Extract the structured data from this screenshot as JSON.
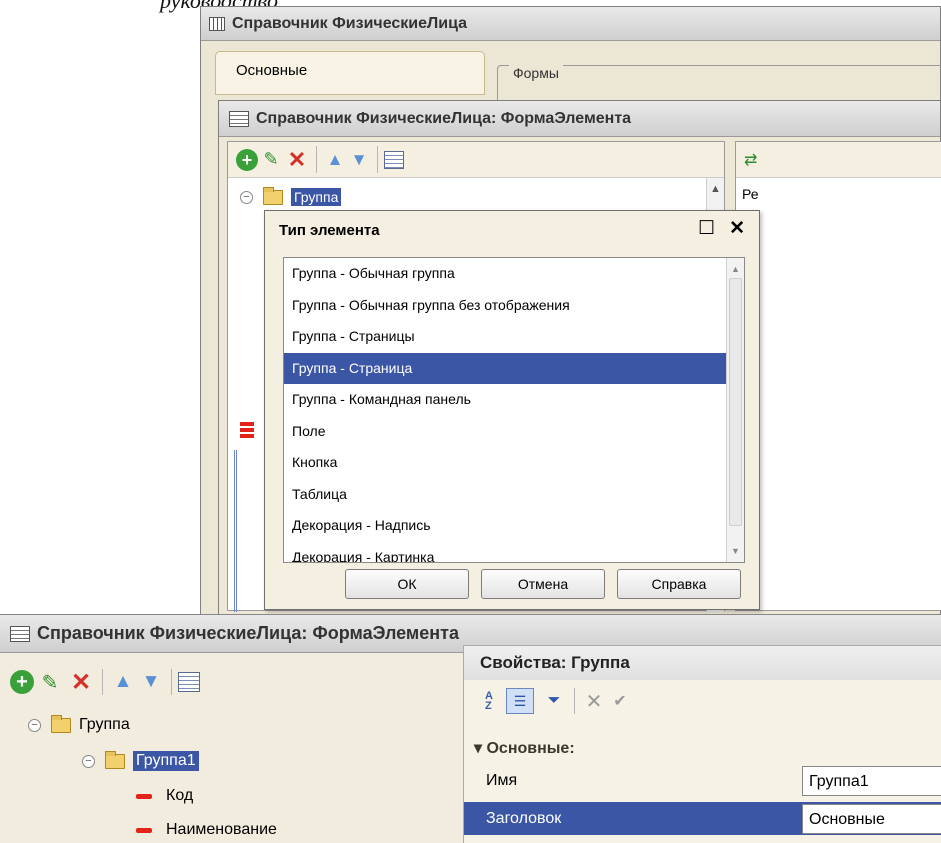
{
  "caption": "руководство",
  "window_main": {
    "title": "Справочник ФизическиеЛица",
    "tab_label": "Основные",
    "forms_group_label": "Формы"
  },
  "window_form": {
    "title": "Справочник ФизическиеЛица: ФормаЭлемента",
    "tree_root": "Группа",
    "right_panel_text": "Ре"
  },
  "dialog": {
    "title": "Тип элемента",
    "items": [
      "Группа - Обычная группа",
      "Группа - Обычная группа без отображения",
      "Группа - Страницы",
      "Группа - Страница",
      "Группа - Командная панель",
      "Поле",
      "Кнопка",
      "Таблица",
      "Декорация - Надпись",
      "Декорация - Картинка"
    ],
    "selected_index": 3,
    "ok_label": "ОК",
    "cancel_label": "Отмена",
    "help_label": "Справка"
  },
  "bottom": {
    "title": "Справочник ФизическиеЛица: ФормаЭлемента",
    "tree": {
      "group": "Группа",
      "group1": "Группа1",
      "field_code": "Код",
      "field_name": "Наименование"
    }
  },
  "properties": {
    "title": "Свойства: Группа",
    "section": "Основные:",
    "rows": [
      {
        "name": "Имя",
        "value": "Группа1"
      },
      {
        "name": "Заголовок",
        "value": "Основные"
      }
    ]
  },
  "colors": {
    "selection": "#3c56a6",
    "window_bg": "#ede7d6",
    "add_green": "#3aa13a",
    "delete_red": "#d4302a",
    "arrow_blue": "#5b8fd6"
  }
}
